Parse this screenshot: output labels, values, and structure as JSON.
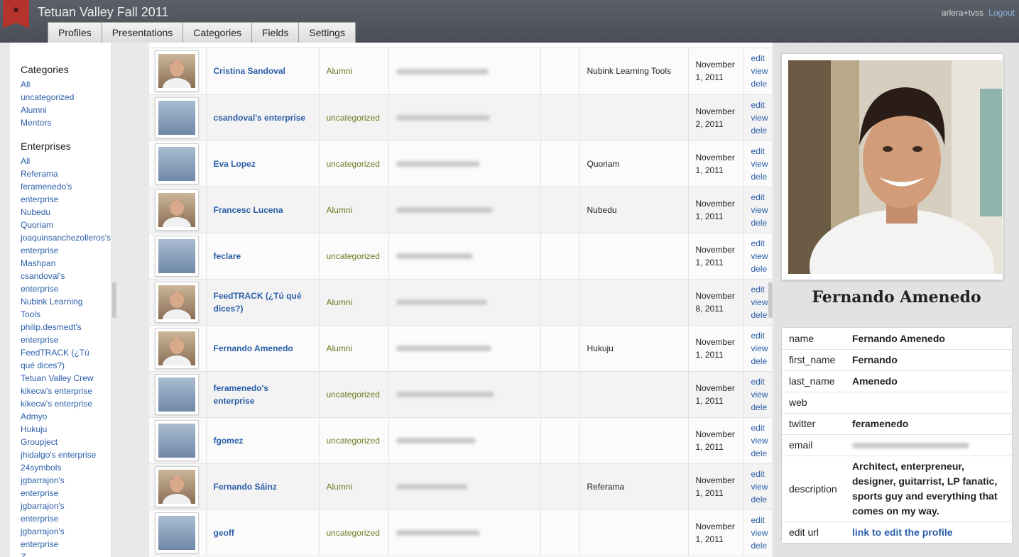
{
  "app": {
    "title": "Tetuan Valley Fall 2011",
    "user": "arlera+tvss",
    "logout": "Logout",
    "logo_icon": "bookmark-icon"
  },
  "tabs": [
    "Profiles",
    "Presentations",
    "Categories",
    "Fields",
    "Settings"
  ],
  "sidebar": {
    "categories_title": "Categories",
    "categories": [
      "All",
      "uncategorized",
      "Alumni",
      "Mentors"
    ],
    "enterprises_title": "Enterprises",
    "enterprises": [
      "All",
      "Referama",
      "feramenedo's",
      "enterprise",
      "Nubedu",
      "Quoriam",
      "joaquinsanchezolleros's",
      "enterprise",
      "Mashpan",
      "csandoval's",
      "enterprise",
      "Nubink Learning",
      "Tools",
      "philip.desmedt's",
      "enterprise",
      "FeedTRACK (¿Tú",
      "qué dices?)",
      "Tetuan Valley Crew",
      "kikecw's enterprise",
      "kikecw's enterprise",
      "Admyo",
      "Hukuju",
      "Groupject",
      "jhidalgo's enterprise",
      "24symbols",
      "jgbarrajon's",
      "enterprise",
      "jgbarrajon's",
      "enterprise",
      "jgbarrajon's",
      "enterprise",
      "Z..."
    ]
  },
  "table": {
    "rows": [
      {
        "name": "Cristina Sandoval",
        "category": "Alumni",
        "email_blurred": true,
        "enterprise": "Nubink Learning Tools",
        "date_line1": "November",
        "date_line2": "1, 2011",
        "edit": "edit",
        "view": "view",
        "delete": "dele",
        "photo": true
      },
      {
        "name": "csandoval's enterprise",
        "category": "uncategorized",
        "email_blurred": true,
        "enterprise": "",
        "date_line1": "November",
        "date_line2": "2, 2011",
        "edit": "edit",
        "view": "view",
        "delete": "dele",
        "photo": false
      },
      {
        "name": "Eva Lopez",
        "category": "uncategorized",
        "email_blurred": true,
        "enterprise": "Quoriam",
        "date_line1": "November",
        "date_line2": "1, 2011",
        "edit": "edit",
        "view": "view",
        "delete": "dele",
        "photo": false
      },
      {
        "name": "Francesc Lucena",
        "category": "Alumni",
        "email_blurred": true,
        "enterprise": "Nubedu",
        "date_line1": "November",
        "date_line2": "1, 2011",
        "edit": "edit",
        "view": "view",
        "delete": "dele",
        "photo": true
      },
      {
        "name": "feclare",
        "category": "uncategorized",
        "email_blurred": true,
        "enterprise": "",
        "date_line1": "November",
        "date_line2": "1, 2011",
        "edit": "edit",
        "view": "view",
        "delete": "dele",
        "photo": false
      },
      {
        "name": "FeedTRACK (¿Tú qué dices?)",
        "category": "Alumni",
        "email_blurred": true,
        "enterprise": "",
        "date_line1": "November",
        "date_line2": "8, 2011",
        "edit": "edit",
        "view": "view",
        "delete": "dele",
        "photo": true
      },
      {
        "name": "Fernando Amenedo",
        "category": "Alumni",
        "email_blurred": true,
        "enterprise": "Hukuju",
        "date_line1": "November",
        "date_line2": "1, 2011",
        "edit": "edit",
        "view": "view",
        "delete": "dele",
        "photo": true
      },
      {
        "name": "feramenedo's enterprise",
        "category": "uncategorized",
        "email_blurred": true,
        "enterprise": "",
        "date_line1": "November",
        "date_line2": "1, 2011",
        "edit": "edit",
        "view": "view",
        "delete": "dele",
        "photo": false
      },
      {
        "name": "fgomez",
        "category": "uncategorized",
        "email_blurred": true,
        "enterprise": "",
        "date_line1": "November",
        "date_line2": "1, 2011",
        "edit": "edit",
        "view": "view",
        "delete": "dele",
        "photo": false
      },
      {
        "name": "Fernando Sáinz",
        "category": "Alumni",
        "email_blurred": true,
        "enterprise": "Referama",
        "date_line1": "November",
        "date_line2": "1, 2011",
        "edit": "edit",
        "view": "view",
        "delete": "dele",
        "photo": true
      },
      {
        "name": "geoff",
        "category": "uncategorized",
        "email_blurred": true,
        "enterprise": "",
        "date_line1": "November",
        "date_line2": "1, 2011",
        "edit": "edit",
        "view": "view",
        "delete": "dele",
        "photo": false
      }
    ]
  },
  "profile": {
    "name": "Fernando Amenedo",
    "fields": [
      {
        "key": "name",
        "value": "Fernando Amenedo"
      },
      {
        "key": "first_name",
        "value": "Fernando"
      },
      {
        "key": "last_name",
        "value": "Amenedo"
      },
      {
        "key": "web",
        "value": ""
      },
      {
        "key": "twitter",
        "value": "feramenedo"
      },
      {
        "key": "email",
        "value": "",
        "blurred": true
      },
      {
        "key": "description",
        "value": "Architect, enterpreneur, designer, guitarrist, LP fanatic, sports guy and everything that comes on my way."
      },
      {
        "key": "edit url",
        "value": "link to edit the profile",
        "link": true
      }
    ]
  }
}
